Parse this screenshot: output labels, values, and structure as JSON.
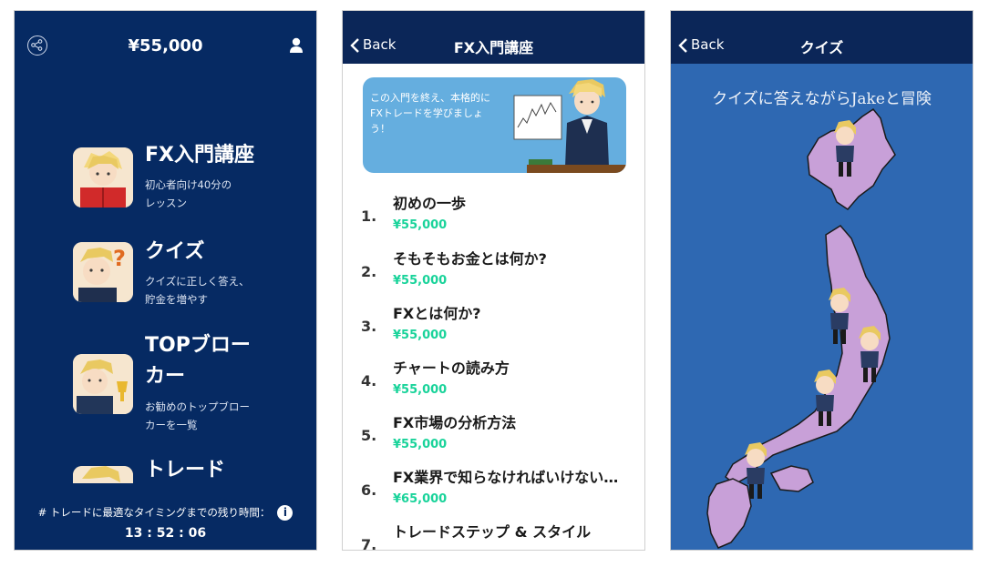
{
  "colors": {
    "navy": "#062a63",
    "navbar": "#0b2658",
    "price_green": "#19d39a",
    "map_blue": "#2e68b2",
    "land": "#c8a0d8"
  },
  "home": {
    "balance": "¥55,000",
    "icons": {
      "share": "share-icon",
      "user": "user-icon"
    },
    "menu": [
      {
        "title": "FX入門講座",
        "subtitle_lines": [
          "初心者向け40分の",
          "レッスン"
        ]
      },
      {
        "title": "クイズ",
        "subtitle_lines": [
          "クイズに正しく答え、",
          "貯金を増やす"
        ]
      },
      {
        "title_lines": [
          "TOPブロー",
          "カー"
        ],
        "subtitle_lines": [
          "お勧めのトップブロー",
          "カーを一覧"
        ]
      },
      {
        "title": "トレード"
      }
    ],
    "timer_label": "# トレードに最適なタイミングまでの残り時間：",
    "timer_info": "i",
    "timer": "13 : 52 : 06"
  },
  "course": {
    "back_label": "Back",
    "title": "FX入門講座",
    "banner_lines": [
      "この入門を終え、本格的に",
      "FXトレードを学びましょ",
      "う！"
    ],
    "lessons": [
      {
        "num": "1.",
        "title": "初めの一歩",
        "price": "¥55,000"
      },
      {
        "num": "2.",
        "title": "そもそもお金とは何か?",
        "price": "¥55,000"
      },
      {
        "num": "3.",
        "title": "FXとは何か?",
        "price": "¥55,000"
      },
      {
        "num": "4.",
        "title": "チャートの読み方",
        "price": "¥55,000"
      },
      {
        "num": "5.",
        "title": "FX市場の分析方法",
        "price": "¥55,000"
      },
      {
        "num": "6.",
        "title": "FX業界で知らなければいけない…",
        "price": "¥65,000"
      },
      {
        "num": "7.",
        "title": "トレードステップ & スタイル",
        "price": ""
      }
    ]
  },
  "quiz": {
    "back_label": "Back",
    "title": "クイズ",
    "heading": "クイズに答えながらJakeと冒険"
  }
}
